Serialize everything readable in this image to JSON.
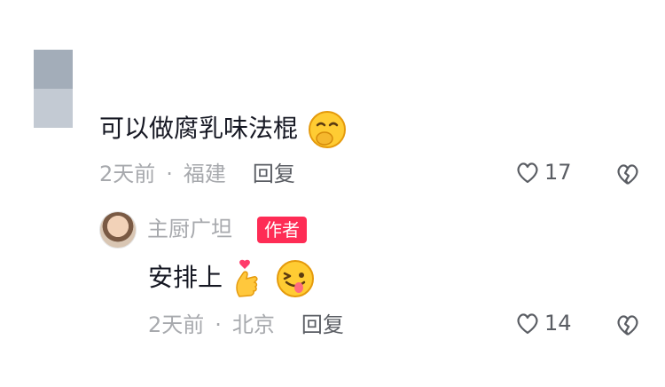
{
  "comment": {
    "text": "可以做腐乳味法棍",
    "emoji": "face-with-hand-over-mouth",
    "time": "2天前",
    "location": "福建",
    "reply_label": "回复",
    "likes": "17"
  },
  "reply": {
    "username": "主厨广坦",
    "badge": "作者",
    "text": "安排上",
    "emojis": [
      "finger-heart",
      "winking-face-with-tongue"
    ],
    "time": "2天前",
    "location": "北京",
    "reply_label": "回复",
    "likes": "14"
  },
  "colors": {
    "primary_text": "#161823",
    "secondary_text": "#a7a9ad",
    "badge": "#fe2c55"
  }
}
